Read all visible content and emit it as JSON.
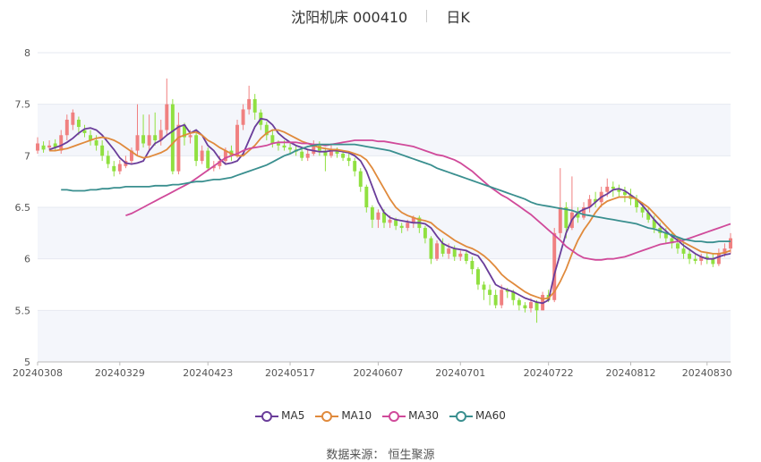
{
  "header": {
    "title": "沈阳机床 000410",
    "period": "日K"
  },
  "source": "数据来源： 恒生聚源",
  "chart_data": {
    "type": "candlestick",
    "ylim": [
      5,
      8
    ],
    "y_ticks": [
      "5",
      "5.5",
      "6",
      "6.5",
      "7",
      "7.5",
      "8"
    ],
    "x_tick_labels": [
      "20240308",
      "20240329",
      "20240423",
      "20240517",
      "20240607",
      "20240701",
      "20240722",
      "20240812",
      "20240830"
    ],
    "x_tick_index": [
      0,
      14,
      29,
      43,
      58,
      72,
      87,
      101,
      114
    ],
    "up_color": "#f08080",
    "down_color": "#90e040",
    "candles": [
      [
        7.05,
        7.12,
        7.18,
        7.02
      ],
      [
        7.1,
        7.06,
        7.14,
        7.03
      ],
      [
        7.08,
        7.1,
        7.15,
        7.05
      ],
      [
        7.12,
        7.08,
        7.16,
        7.05
      ],
      [
        7.05,
        7.2,
        7.25,
        7.02
      ],
      [
        7.2,
        7.35,
        7.4,
        7.15
      ],
      [
        7.3,
        7.42,
        7.45,
        7.25
      ],
      [
        7.35,
        7.28,
        7.38,
        7.2
      ],
      [
        7.25,
        7.22,
        7.3,
        7.18
      ],
      [
        7.2,
        7.15,
        7.25,
        7.1
      ],
      [
        7.15,
        7.1,
        7.2,
        7.05
      ],
      [
        7.1,
        7.0,
        7.15,
        6.95
      ],
      [
        7.0,
        6.92,
        7.05,
        6.88
      ],
      [
        6.9,
        6.85,
        6.95,
        6.8
      ],
      [
        6.85,
        6.92,
        6.96,
        6.82
      ],
      [
        6.9,
        6.95,
        7.0,
        6.88
      ],
      [
        6.95,
        7.05,
        7.08,
        6.92
      ],
      [
        7.05,
        7.2,
        7.5,
        7.0
      ],
      [
        7.2,
        7.12,
        7.4,
        7.08
      ],
      [
        7.1,
        7.2,
        7.4,
        7.05
      ],
      [
        7.2,
        7.15,
        7.42,
        7.1
      ],
      [
        7.15,
        7.25,
        7.35,
        7.1
      ],
      [
        7.25,
        7.5,
        7.75,
        7.2
      ],
      [
        7.5,
        6.85,
        7.55,
        6.82
      ],
      [
        6.85,
        7.3,
        7.42,
        6.82
      ],
      [
        7.3,
        7.18,
        7.32,
        7.1
      ],
      [
        7.18,
        7.2,
        7.25,
        7.12
      ],
      [
        7.2,
        6.95,
        7.22,
        6.9
      ],
      [
        6.95,
        7.05,
        7.1,
        6.92
      ],
      [
        7.05,
        6.88,
        7.08,
        6.85
      ],
      [
        6.88,
        6.9,
        6.95,
        6.85
      ],
      [
        6.9,
        6.95,
        7.0,
        6.87
      ],
      [
        6.95,
        7.05,
        7.08,
        6.93
      ],
      [
        7.05,
        7.0,
        7.1,
        6.95
      ],
      [
        7.0,
        7.3,
        7.35,
        6.98
      ],
      [
        7.3,
        7.45,
        7.5,
        7.25
      ],
      [
        7.45,
        7.55,
        7.68,
        7.4
      ],
      [
        7.55,
        7.42,
        7.6,
        7.35
      ],
      [
        7.42,
        7.3,
        7.45,
        7.25
      ],
      [
        7.3,
        7.2,
        7.33,
        7.15
      ],
      [
        7.2,
        7.12,
        7.25,
        7.08
      ],
      [
        7.12,
        7.1,
        7.15,
        7.05
      ],
      [
        7.1,
        7.08,
        7.15,
        7.05
      ],
      [
        7.08,
        7.06,
        7.12,
        7.02
      ],
      [
        7.06,
        7.04,
        7.1,
        7.0
      ],
      [
        7.04,
        6.98,
        7.08,
        6.95
      ],
      [
        6.98,
        7.02,
        7.06,
        6.95
      ],
      [
        7.02,
        7.1,
        7.15,
        7.0
      ],
      [
        7.1,
        7.05,
        7.14,
        7.0
      ],
      [
        7.05,
        7.0,
        7.08,
        6.85
      ],
      [
        7.0,
        7.05,
        7.12,
        6.98
      ],
      [
        7.05,
        7.02,
        7.08,
        6.98
      ],
      [
        7.02,
        6.98,
        7.05,
        6.95
      ],
      [
        6.98,
        6.95,
        7.02,
        6.9
      ],
      [
        6.95,
        6.85,
        6.98,
        6.8
      ],
      [
        6.85,
        6.7,
        6.88,
        6.65
      ],
      [
        6.7,
        6.5,
        6.72,
        6.45
      ],
      [
        6.5,
        6.38,
        6.52,
        6.3
      ],
      [
        6.38,
        6.45,
        6.48,
        6.3
      ],
      [
        6.45,
        6.35,
        6.48,
        6.3
      ],
      [
        6.35,
        6.38,
        6.42,
        6.3
      ],
      [
        6.38,
        6.32,
        6.4,
        6.28
      ],
      [
        6.32,
        6.3,
        6.35,
        6.25
      ],
      [
        6.3,
        6.35,
        6.38,
        6.27
      ],
      [
        6.35,
        6.4,
        6.42,
        6.3
      ],
      [
        6.4,
        6.3,
        6.42,
        6.25
      ],
      [
        6.3,
        6.2,
        6.32,
        6.15
      ],
      [
        6.2,
        6.0,
        6.22,
        5.95
      ],
      [
        6.0,
        6.15,
        6.18,
        5.98
      ],
      [
        6.15,
        6.05,
        6.2,
        6.02
      ],
      [
        6.05,
        6.1,
        6.15,
        6.0
      ],
      [
        6.1,
        6.02,
        6.13,
        5.98
      ],
      [
        6.02,
        6.05,
        6.08,
        5.98
      ],
      [
        6.05,
        5.98,
        6.08,
        5.95
      ],
      [
        5.98,
        5.9,
        6.02,
        5.85
      ],
      [
        5.9,
        5.75,
        5.92,
        5.7
      ],
      [
        5.75,
        5.7,
        5.78,
        5.6
      ],
      [
        5.7,
        5.65,
        5.75,
        5.55
      ],
      [
        5.65,
        5.55,
        5.7,
        5.52
      ],
      [
        5.55,
        5.7,
        5.75,
        5.52
      ],
      [
        5.7,
        5.68,
        5.72,
        5.62
      ],
      [
        5.68,
        5.6,
        5.7,
        5.55
      ],
      [
        5.6,
        5.55,
        5.62,
        5.5
      ],
      [
        5.55,
        5.52,
        5.58,
        5.48
      ],
      [
        5.52,
        5.58,
        5.62,
        5.48
      ],
      [
        5.58,
        5.5,
        5.6,
        5.38
      ],
      [
        5.5,
        5.65,
        5.68,
        5.5
      ],
      [
        5.65,
        5.6,
        5.7,
        5.58
      ],
      [
        5.6,
        6.25,
        6.3,
        5.58
      ],
      [
        6.25,
        6.5,
        6.88,
        6.2
      ],
      [
        6.5,
        6.3,
        6.55,
        6.2
      ],
      [
        6.3,
        6.45,
        6.8,
        6.28
      ],
      [
        6.45,
        6.4,
        6.5,
        6.35
      ],
      [
        6.4,
        6.5,
        6.55,
        6.38
      ],
      [
        6.5,
        6.58,
        6.62,
        6.45
      ],
      [
        6.58,
        6.55,
        6.65,
        6.5
      ],
      [
        6.55,
        6.65,
        6.7,
        6.5
      ],
      [
        6.65,
        6.7,
        6.78,
        6.6
      ],
      [
        6.7,
        6.68,
        6.75,
        6.6
      ],
      [
        6.68,
        6.65,
        6.72,
        6.6
      ],
      [
        6.65,
        6.62,
        6.7,
        6.55
      ],
      [
        6.62,
        6.58,
        6.68,
        6.52
      ],
      [
        6.58,
        6.5,
        6.62,
        6.45
      ],
      [
        6.5,
        6.45,
        6.55,
        6.4
      ],
      [
        6.45,
        6.38,
        6.5,
        6.35
      ],
      [
        6.38,
        6.3,
        6.42,
        6.25
      ],
      [
        6.3,
        6.25,
        6.35,
        6.2
      ],
      [
        6.25,
        6.2,
        6.3,
        6.15
      ],
      [
        6.2,
        6.15,
        6.25,
        6.1
      ],
      [
        6.15,
        6.1,
        6.2,
        6.05
      ],
      [
        6.1,
        6.05,
        6.15,
        6.0
      ],
      [
        6.05,
        6.0,
        6.1,
        5.95
      ],
      [
        6.0,
        5.98,
        6.05,
        5.95
      ],
      [
        5.98,
        6.02,
        6.05,
        5.94
      ],
      [
        6.02,
        6.0,
        6.06,
        5.95
      ],
      [
        6.0,
        5.95,
        6.05,
        5.92
      ],
      [
        5.95,
        6.05,
        6.1,
        5.93
      ],
      [
        6.05,
        6.1,
        6.15,
        6.02
      ],
      [
        6.1,
        6.2,
        6.25,
        6.05
      ]
    ],
    "series": [
      {
        "name": "MA5",
        "color": "#6a3d9a",
        "values": [
          7.06,
          7.08,
          7.1,
          7.13,
          7.17,
          7.22,
          7.26,
          7.27,
          7.25,
          7.2,
          7.13,
          7.06,
          6.98,
          6.93,
          6.92,
          6.93,
          6.95,
          7.05,
          7.12,
          7.15,
          7.2,
          7.24,
          7.28,
          7.3,
          7.22,
          7.25,
          7.2,
          7.1,
          7.05,
          6.97,
          6.92,
          6.93,
          6.95,
          7.02,
          7.15,
          7.28,
          7.36,
          7.35,
          7.3,
          7.22,
          7.17,
          7.13,
          7.1,
          7.08,
          7.06,
          7.05,
          7.04,
          7.04,
          7.05,
          7.05,
          7.04,
          7.03,
          7.0,
          6.95,
          6.85,
          6.7,
          6.55,
          6.45,
          6.4,
          6.38,
          6.37,
          6.36,
          6.35,
          6.35,
          6.34,
          6.3,
          6.22,
          6.15,
          6.12,
          6.1,
          6.09,
          6.08,
          6.05,
          6.03,
          5.95,
          5.85,
          5.75,
          5.72,
          5.7,
          5.68,
          5.65,
          5.62,
          5.6,
          5.58,
          5.57,
          5.6,
          5.85,
          6.05,
          6.25,
          6.38,
          6.45,
          6.48,
          6.5,
          6.55,
          6.6,
          6.63,
          6.67,
          6.68,
          6.66,
          6.62,
          6.58,
          6.52,
          6.45,
          6.38,
          6.32,
          6.27,
          6.22,
          6.18,
          6.13,
          6.09,
          6.05,
          6.02,
          6.0,
          6.0,
          6.02,
          6.04,
          6.05
        ]
      },
      {
        "name": "MA10",
        "color": "#e08a3c",
        "values": [
          7.05,
          7.05,
          7.06,
          7.07,
          7.09,
          7.11,
          7.13,
          7.15,
          7.17,
          7.18,
          7.17,
          7.15,
          7.12,
          7.08,
          7.04,
          7.0,
          6.98,
          6.99,
          7.01,
          7.03,
          7.06,
          7.12,
          7.18,
          7.2,
          7.22,
          7.23,
          7.2,
          7.15,
          7.12,
          7.08,
          7.05,
          7.02,
          7.0,
          7.0,
          7.05,
          7.1,
          7.17,
          7.22,
          7.25,
          7.25,
          7.23,
          7.2,
          7.17,
          7.14,
          7.12,
          7.1,
          7.08,
          7.07,
          7.06,
          7.06,
          7.05,
          7.04,
          7.02,
          7.0,
          6.96,
          6.88,
          6.78,
          6.68,
          6.58,
          6.5,
          6.45,
          6.42,
          6.4,
          6.38,
          6.37,
          6.35,
          6.3,
          6.26,
          6.22,
          6.18,
          6.15,
          6.12,
          6.1,
          6.07,
          6.03,
          5.98,
          5.92,
          5.85,
          5.8,
          5.76,
          5.72,
          5.68,
          5.65,
          5.63,
          5.61,
          5.62,
          5.68,
          5.78,
          5.9,
          6.05,
          6.18,
          6.28,
          6.36,
          6.45,
          6.52,
          6.56,
          6.58,
          6.6,
          6.6,
          6.6,
          6.58,
          6.54,
          6.5,
          6.44,
          6.38,
          6.32,
          6.26,
          6.2,
          6.16,
          6.13,
          6.1,
          6.07,
          6.06,
          6.05,
          6.05,
          6.06,
          6.08
        ]
      },
      {
        "name": "MA30",
        "color": "#d04a9a",
        "values": [
          6.42,
          6.44,
          6.47,
          6.5,
          6.53,
          6.56,
          6.59,
          6.62,
          6.65,
          6.68,
          6.71,
          6.74,
          6.78,
          6.82,
          6.86,
          6.9,
          6.94,
          6.98,
          7.0,
          7.02,
          7.05,
          7.07,
          7.08,
          7.09,
          7.1,
          7.12,
          7.13,
          7.13,
          7.13,
          7.13,
          7.12,
          7.12,
          7.11,
          7.11,
          7.1,
          7.11,
          7.12,
          7.13,
          7.14,
          7.15,
          7.15,
          7.15,
          7.15,
          7.14,
          7.14,
          7.13,
          7.12,
          7.11,
          7.1,
          7.09,
          7.07,
          7.05,
          7.03,
          7.01,
          7.0,
          6.98,
          6.96,
          6.93,
          6.89,
          6.85,
          6.8,
          6.75,
          6.7,
          6.66,
          6.62,
          6.59,
          6.55,
          6.51,
          6.47,
          6.43,
          6.38,
          6.33,
          6.28,
          6.23,
          6.18,
          6.12,
          6.08,
          6.04,
          6.01,
          6.0,
          5.99,
          5.99,
          6.0,
          6.0,
          6.01,
          6.02,
          6.04,
          6.06,
          6.08,
          6.1,
          6.12,
          6.14,
          6.15,
          6.16,
          6.17,
          6.18,
          6.2,
          6.22,
          6.24,
          6.26,
          6.28,
          6.3,
          6.32,
          6.34
        ]
      },
      {
        "name": "MA60",
        "color": "#3a8f8f",
        "values": [
          6.67,
          6.67,
          6.66,
          6.66,
          6.66,
          6.67,
          6.67,
          6.68,
          6.68,
          6.69,
          6.69,
          6.7,
          6.7,
          6.7,
          6.7,
          6.7,
          6.71,
          6.71,
          6.71,
          6.72,
          6.72,
          6.73,
          6.74,
          6.75,
          6.75,
          6.76,
          6.77,
          6.77,
          6.78,
          6.79,
          6.81,
          6.83,
          6.85,
          6.87,
          6.89,
          6.91,
          6.94,
          6.97,
          7.0,
          7.02,
          7.05,
          7.07,
          7.09,
          7.1,
          7.11,
          7.11,
          7.11,
          7.11,
          7.11,
          7.11,
          7.11,
          7.1,
          7.09,
          7.08,
          7.07,
          7.06,
          7.05,
          7.03,
          7.01,
          6.99,
          6.97,
          6.95,
          6.93,
          6.91,
          6.88,
          6.86,
          6.84,
          6.82,
          6.8,
          6.78,
          6.76,
          6.74,
          6.72,
          6.7,
          6.68,
          6.66,
          6.64,
          6.62,
          6.6,
          6.58,
          6.55,
          6.53,
          6.52,
          6.51,
          6.5,
          6.49,
          6.48,
          6.47,
          6.45,
          6.43,
          6.42,
          6.41,
          6.4,
          6.39,
          6.38,
          6.37,
          6.36,
          6.35,
          6.34,
          6.32,
          6.3,
          6.29,
          6.27,
          6.25,
          6.23,
          6.21,
          6.19,
          6.18,
          6.17,
          6.17,
          6.16,
          6.16,
          6.17,
          6.17,
          6.17
        ]
      }
    ]
  }
}
